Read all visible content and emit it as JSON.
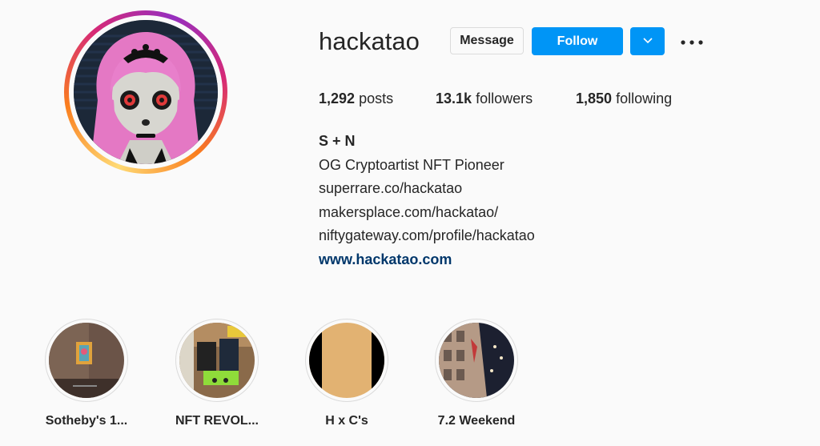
{
  "profile": {
    "username": "hackatao",
    "message_label": "Message",
    "follow_label": "Follow",
    "accent_color": "#0095f6",
    "stats": {
      "posts_count": "1,292",
      "posts_label": "posts",
      "followers_count": "13.1k",
      "followers_label": "followers",
      "following_count": "1,850",
      "following_label": "following"
    },
    "bio": {
      "name": "S + N",
      "lines": [
        "OG Cryptoartist NFT Pioneer",
        "superrare.co/hackatao",
        "makersplace.com/hackatao/",
        "niftygateway.com/profile/hackatao"
      ],
      "website": "www.hackatao.com"
    }
  },
  "highlights": [
    {
      "label": "Sotheby's 1..."
    },
    {
      "label": "NFT REVOL..."
    },
    {
      "label": "H x C's"
    },
    {
      "label": "7.2 Weekend"
    }
  ],
  "icons": {
    "dropdown": "chevron-down-icon",
    "more": "more-options-icon"
  }
}
